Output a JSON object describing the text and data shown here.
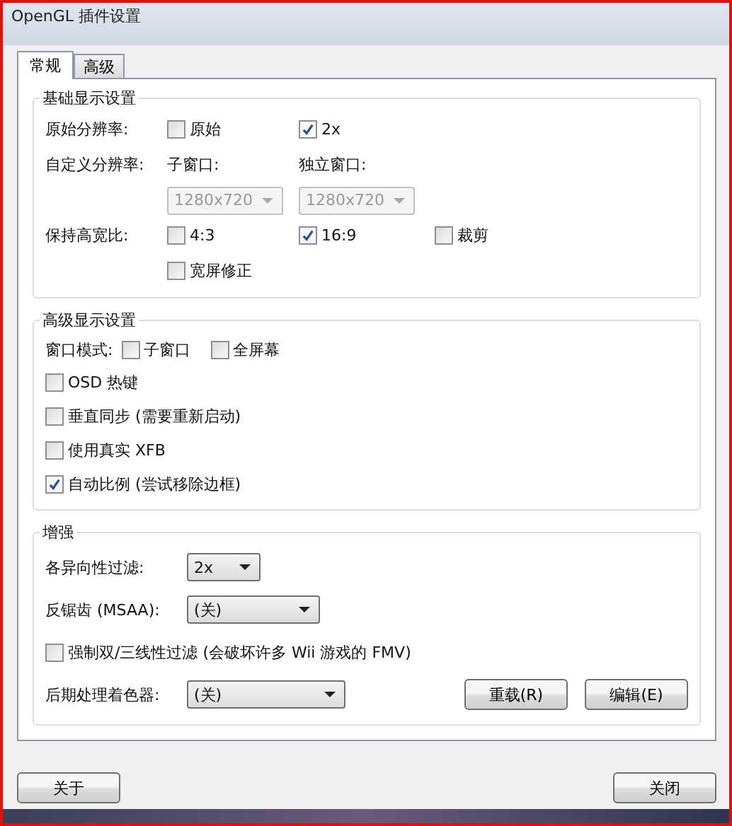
{
  "window": {
    "title": "OpenGL 插件设置"
  },
  "tabs": [
    {
      "label": "常规",
      "selected": true
    },
    {
      "label": "高级",
      "selected": false
    }
  ],
  "basic": {
    "title": "基础显示设置",
    "rows": [
      {
        "label": "原始分辨率:",
        "items": [
          {
            "kind": "checkbox",
            "label": "原始",
            "checked": false
          },
          {
            "kind": "checkbox",
            "label": "2x",
            "checked": true
          }
        ]
      },
      {
        "label": "自定义分辨率:",
        "items": [
          {
            "kind": "text",
            "label": "子窗口:"
          },
          {
            "kind": "text",
            "label": "独立窗口:"
          }
        ]
      },
      {
        "items": [
          {
            "kind": "select",
            "value": "1280x720",
            "disabled": true
          },
          {
            "kind": "select",
            "value": "1280x720",
            "disabled": true
          }
        ]
      },
      {
        "label": "保持高宽比:",
        "items": [
          {
            "kind": "checkbox",
            "label": "4:3",
            "checked": false
          },
          {
            "kind": "checkbox",
            "label": "16:9",
            "checked": true
          },
          {
            "kind": "checkbox",
            "label": "裁剪",
            "checked": false
          }
        ]
      },
      {
        "items": [
          {
            "kind": "checkbox",
            "label": "宽屏修正",
            "checked": false
          }
        ]
      }
    ]
  },
  "advanced": {
    "title": "高级显示设置",
    "window_mode": {
      "label": "窗口模式:",
      "options": [
        {
          "label": "子窗口",
          "checked": false
        },
        {
          "label": "全屏幕",
          "checked": false
        }
      ]
    },
    "options": [
      {
        "label": "OSD 热键",
        "checked": false
      },
      {
        "label": "垂直同步 (需要重新启动)",
        "checked": false
      },
      {
        "label": "使用真实 XFB",
        "checked": false
      },
      {
        "label": "自动比例 (尝试移除边框)",
        "checked": true
      }
    ]
  },
  "enhance": {
    "title": "增强",
    "rows": [
      {
        "kind": "select",
        "label": "各异向性过滤:",
        "value": "2x"
      },
      {
        "kind": "select",
        "label": "反锯齿 (MSAA):",
        "value": "(关)"
      },
      {
        "kind": "checkbox",
        "label": "强制双/三线性过滤 (会破坏许多 Wii 游戏的 FMV)",
        "checked": false
      },
      {
        "kind": "shader",
        "label": "后期处理着色器:",
        "value": "(关)",
        "buttons": [
          "重载(R)",
          "编辑(E)"
        ]
      }
    ]
  },
  "footer": {
    "buttons": [
      "关于",
      "关闭"
    ]
  }
}
